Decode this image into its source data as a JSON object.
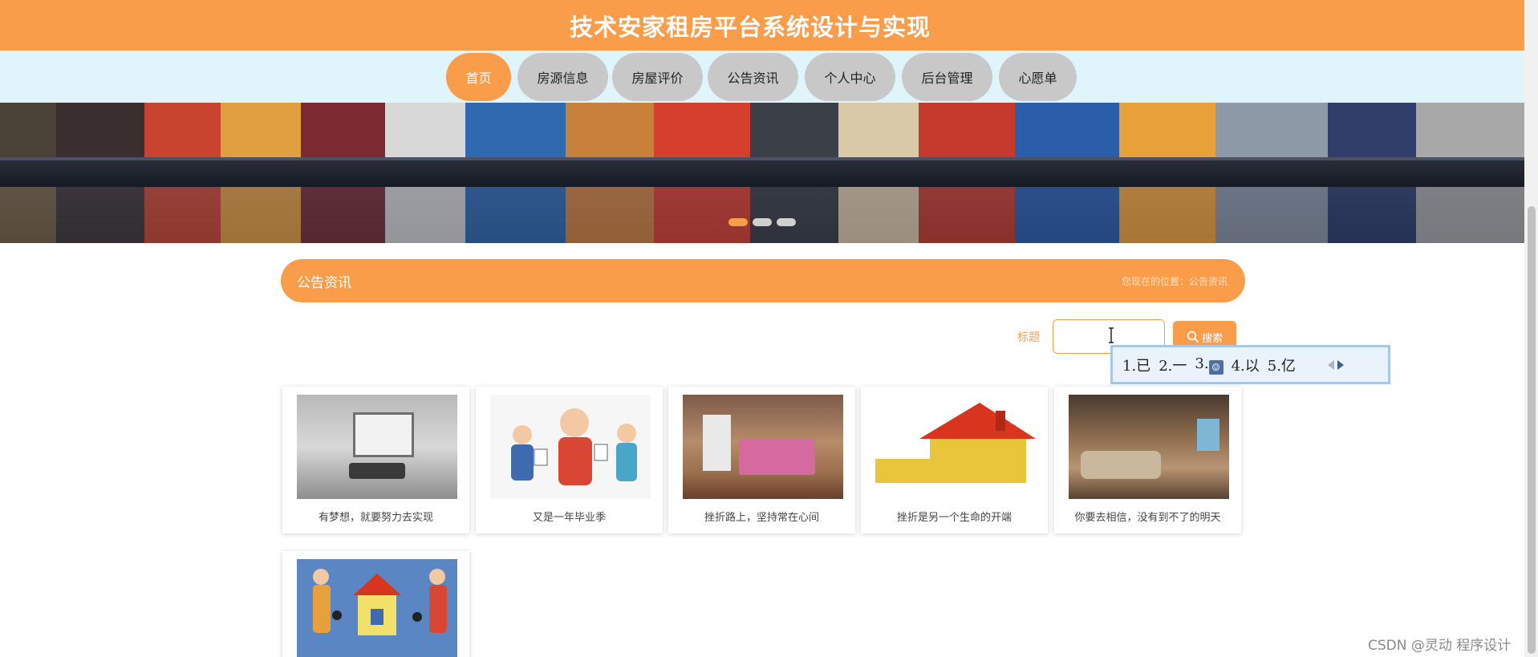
{
  "header": {
    "title": "技术安家租房平台系统设计与实现"
  },
  "nav": {
    "items": [
      {
        "label": "首页",
        "active": true
      },
      {
        "label": "房源信息"
      },
      {
        "label": "房屋评价"
      },
      {
        "label": "公告资讯"
      },
      {
        "label": "个人中心"
      },
      {
        "label": "后台管理"
      },
      {
        "label": "心愿单"
      }
    ]
  },
  "banner": {
    "slide_count": 3,
    "active_slide": 1
  },
  "section": {
    "title": "公告资讯",
    "breadcrumb": "您现在的位置：公告资讯"
  },
  "search": {
    "label": "标题",
    "input_value": "",
    "button_label": "搜索"
  },
  "ime": {
    "candidates": [
      "1.已",
      "2.一",
      "3.",
      "4.以",
      "5.亿"
    ]
  },
  "news": [
    {
      "caption": "有梦想，就要努力去实现",
      "image": "empty-room"
    },
    {
      "caption": "又是一年毕业季",
      "image": "cartoon-handshake"
    },
    {
      "caption": "挫折路上，坚持常在心间",
      "image": "bedroom"
    },
    {
      "caption": "挫折是另一个生命的开端",
      "image": "for-rent-house"
    },
    {
      "caption": "你要去相信，没有到不了的明天",
      "image": "living-room"
    },
    {
      "caption": "",
      "image": "people-with-house"
    }
  ],
  "watermark": "CSDN @灵动 程序设计",
  "colors": {
    "accent": "#fa9d4b",
    "nav_bg": "#dff4fb",
    "nav_item": "#c8c8c8"
  }
}
